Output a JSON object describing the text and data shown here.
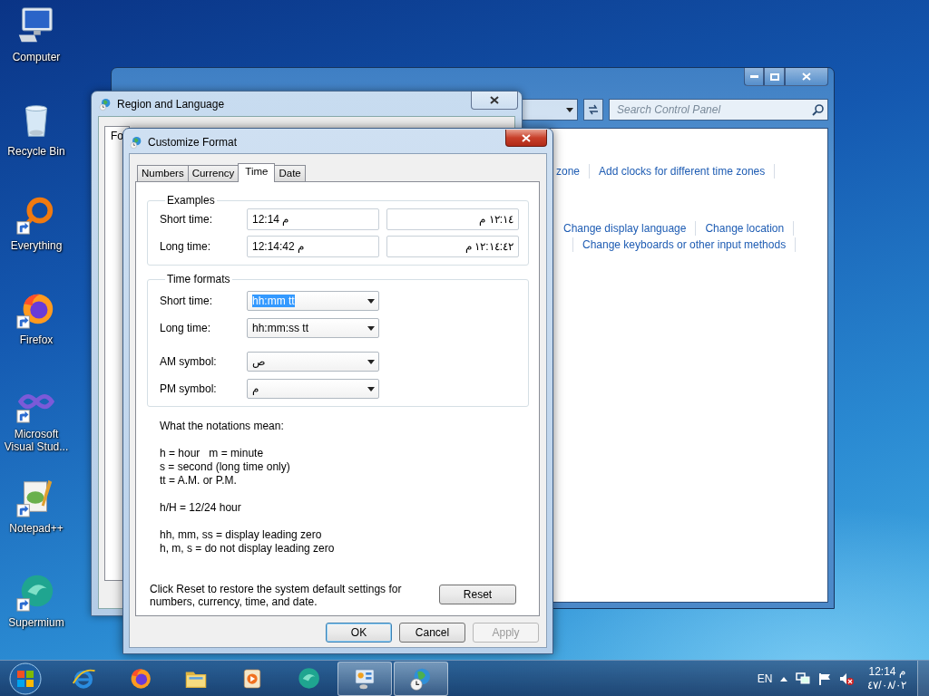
{
  "desktop_icons": [
    {
      "label": "Computer",
      "kind": "computer",
      "shortcut": false
    },
    {
      "label": "Recycle Bin",
      "kind": "recycle",
      "shortcut": false
    },
    {
      "label": "Everything",
      "kind": "ring",
      "shortcut": true
    },
    {
      "label": "Firefox",
      "kind": "firefox",
      "shortcut": true
    },
    {
      "label": "Microsoft Visual Stud...",
      "kind": "vs",
      "shortcut": true
    },
    {
      "label": "Notepad++",
      "kind": "notepad",
      "shortcut": true
    },
    {
      "label": "Supermium",
      "kind": "supermium",
      "shortcut": true
    }
  ],
  "control_panel_window": {
    "search": {
      "placeholder": "Search Control Panel"
    },
    "link_rows": [
      [
        {
          "text": "zone"
        },
        {
          "text": "Add clocks for different time zones"
        }
      ],
      [
        {
          "text": "Change display language"
        },
        {
          "text": "Change location"
        }
      ],
      [
        {
          "text": "Change keyboards or other input methods"
        }
      ]
    ]
  },
  "region_window": {
    "title": "Region and Language",
    "tabs": [
      {
        "label": "Fo",
        "selected": true
      }
    ]
  },
  "dialog": {
    "title": "Customize Format",
    "tabs": [
      {
        "label": "Numbers",
        "selected": false
      },
      {
        "label": "Currency",
        "selected": false
      },
      {
        "label": "Time",
        "selected": true
      },
      {
        "label": "Date",
        "selected": false
      }
    ],
    "examples": {
      "title": "Examples",
      "rows": [
        {
          "label": "Short time:",
          "value": "12:14 م",
          "value_rtl": "١٢:١٤ م"
        },
        {
          "label": "Long time:",
          "value": "12:14:42 م",
          "value_rtl": "١٢:١٤:٤٢ م"
        }
      ]
    },
    "time_formats": {
      "title": "Time formats",
      "rows": [
        {
          "label": "Short time:",
          "value": "hh:mm tt",
          "text_selected": true
        },
        {
          "label": "Long time:",
          "value": "hh:mm:ss tt",
          "text_selected": false
        },
        {
          "label": "AM symbol:",
          "value": "ص",
          "text_selected": false
        },
        {
          "label": "PM symbol:",
          "value": "م",
          "text_selected": false
        }
      ]
    },
    "notation_paragraphs": [
      [
        "What the notations mean:"
      ],
      [
        "h = hour   m = minute",
        "s = second (long time only)",
        "tt = A.M. or P.M."
      ],
      [
        "h/H = 12/24 hour"
      ],
      [
        "hh, mm, ss = display leading zero",
        "h, m, s = do not display leading zero"
      ]
    ],
    "reset_note": "Click Reset to restore the system default settings for numbers, currency, time, and date.",
    "reset_button": "Reset",
    "buttons": [
      {
        "label": "OK",
        "default": true,
        "disabled": false
      },
      {
        "label": "Cancel",
        "default": false,
        "disabled": false
      },
      {
        "label": "Apply",
        "default": false,
        "disabled": true
      }
    ]
  },
  "taskbar": {
    "apps": [
      {
        "kind": "ie",
        "active": false
      },
      {
        "kind": "firefox",
        "active": false
      },
      {
        "kind": "explorer",
        "active": false
      },
      {
        "kind": "media",
        "active": false
      },
      {
        "kind": "supermium",
        "active": false
      },
      {
        "kind": "cpanel",
        "active": true
      },
      {
        "kind": "region",
        "active": true
      }
    ],
    "language": "EN",
    "time": "12:14 م",
    "date": "٤٧/٠٨/٠٢"
  }
}
